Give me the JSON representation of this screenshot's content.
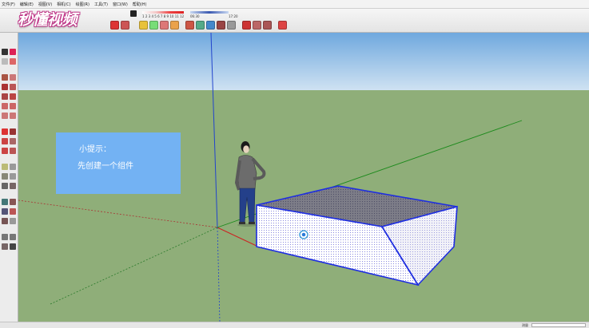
{
  "menu": {
    "items": [
      "文件(F)",
      "编辑(E)",
      "视图(V)",
      "相机(C)",
      "绘图(R)",
      "工具(T)",
      "窗口(W)",
      "帮助(H)"
    ]
  },
  "watermark": {
    "logo_text": "秒懂视频"
  },
  "shadow_panel": {
    "month_numbers": "1 2 3 4 5 6 7 8 9 10 11 12",
    "time_start": "06:30",
    "time_end": "17:20"
  },
  "tip": {
    "title": "小提示：",
    "body": "先创建一个组件"
  },
  "status": {
    "measurement_label": "测量"
  },
  "colors": {
    "sky_top": "#6fa8de",
    "sky_bottom": "#cfe2f2",
    "ground": "#8fae79",
    "selection_blue": "#1f2fe0",
    "tip_background": "#73b2f3"
  }
}
